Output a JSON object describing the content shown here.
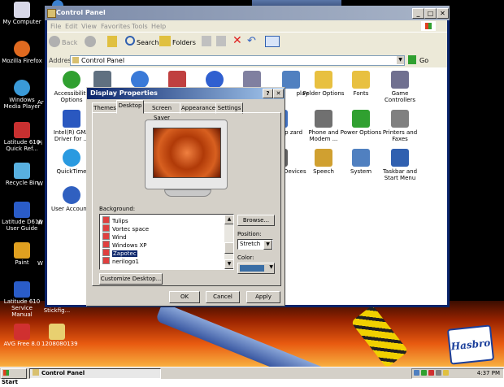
{
  "desktop": {
    "icons": [
      {
        "label": "My Computer",
        "color": "#d8d8e8"
      },
      {
        "label": "Mozilla Firefox",
        "color": "#e06a20"
      },
      {
        "label": "Windows Media Player",
        "color": "#3a9ad8"
      },
      {
        "label": "Latitude 610 Quick Ref...",
        "color": "#c83030"
      },
      {
        "label": "Recycle Bin",
        "color": "#58b0e0"
      },
      {
        "label": "Latitude D610 User Guide",
        "color": "#2a5cc8"
      },
      {
        "label": "Paint",
        "color": "#e0a020"
      },
      {
        "label": "Latitude 610 Service Manual",
        "color": "#2a5cc8"
      },
      {
        "label": "AVG Free 8.0",
        "color": "#d03030"
      }
    ],
    "partial_labels": [
      "Ar",
      "Pi",
      "W",
      "W",
      "W"
    ],
    "lower_icons": [
      {
        "label": "Stickfig...",
        "color": "#c8c8c8"
      },
      {
        "label": "1208080139",
        "color": "#e8d070"
      }
    ],
    "brand": "Hasbro"
  },
  "window": {
    "title": "Control Panel",
    "menu": [
      "File",
      "Edit",
      "View",
      "Favorites",
      "Tools",
      "Help"
    ],
    "toolbar": {
      "back": "Back",
      "search": "Search",
      "folders": "Folders"
    },
    "address_label": "Address",
    "address_value": "Control Panel",
    "go_label": "Go",
    "items": [
      {
        "label": "Accessibility Options",
        "color": "#30a030"
      },
      {
        "label": "",
        "color": "#607080"
      },
      {
        "label": "",
        "color": "#3a7ad8"
      },
      {
        "label": "",
        "color": "#c04040"
      },
      {
        "label": "",
        "color": "#3060d0"
      },
      {
        "label": "",
        "color": "#8080a0"
      },
      {
        "label": "play",
        "color": "#5080c0"
      },
      {
        "label": "Folder Options",
        "color": "#e8c040"
      },
      {
        "label": "Fonts",
        "color": "#e8c040"
      },
      {
        "label": "Game Controllers",
        "color": "#707090"
      },
      {
        "label": "Intel(R) GMA Driver for ...",
        "color": "#2a58c0"
      },
      {
        "label": "k Setup zard",
        "color": "#4070c0"
      },
      {
        "label": "Phone and Modem ...",
        "color": "#707070"
      },
      {
        "label": "Power Options",
        "color": "#30a030"
      },
      {
        "label": "Printers and Faxes",
        "color": "#808080"
      },
      {
        "label": "QuickTime",
        "color": "#2a9ae0"
      },
      {
        "label": "ds and Devices",
        "color": "#606060"
      },
      {
        "label": "Speech",
        "color": "#d0a030"
      },
      {
        "label": "System",
        "color": "#5080c0"
      },
      {
        "label": "Taskbar and Start Menu",
        "color": "#3060b0"
      },
      {
        "label": "User Accounts",
        "color": "#3060c0"
      }
    ]
  },
  "dialog": {
    "title": "Display Properties",
    "tabs": [
      "Themes",
      "Desktop",
      "Screen Saver",
      "Appearance",
      "Settings"
    ],
    "active_tab": "Desktop",
    "background_label": "Background:",
    "backgrounds": [
      "Tulips",
      "Vortec space",
      "Wind",
      "Windows XP",
      "Zapotec",
      "nerilogo1"
    ],
    "selected_background": "Zapotec",
    "browse": "Browse...",
    "position_label": "Position:",
    "position_value": "Stretch",
    "color_label": "Color:",
    "color_value": "#3a6ea5",
    "customize": "Customize Desktop...",
    "ok": "OK",
    "cancel": "Cancel",
    "apply": "Apply"
  },
  "taskbar": {
    "start": "Start",
    "task_title": "Control Panel",
    "clock": "4:37 PM"
  }
}
